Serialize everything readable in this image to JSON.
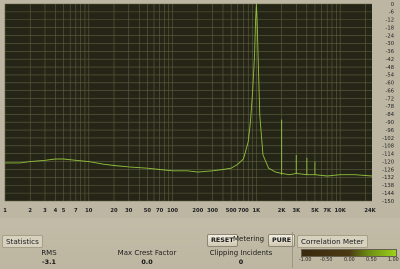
{
  "chart_data": {
    "type": "line",
    "title": "",
    "xlabel": "",
    "ylabel": "",
    "x_scale": "log",
    "xlim": [
      1,
      24000
    ],
    "ylim": [
      -150,
      0
    ],
    "grid": true,
    "x_ticks": [
      "1",
      "2",
      "3",
      "4",
      "5",
      "7",
      "10",
      "20",
      "30",
      "50",
      "70",
      "100",
      "200",
      "300",
      "500",
      "700",
      "1K",
      "2K",
      "3K",
      "5K",
      "7K",
      "10K",
      "24K"
    ],
    "y_ticks": [
      "0",
      "-6",
      "-12",
      "-18",
      "-24",
      "-30",
      "-36",
      "-42",
      "-48",
      "-54",
      "-60",
      "-66",
      "-72",
      "-78",
      "-84",
      "-90",
      "-96",
      "-102",
      "-108",
      "-114",
      "-120",
      "-126",
      "-132",
      "-138",
      "-144",
      "-150"
    ],
    "series": [
      {
        "x": [
          1,
          1.5,
          2,
          3,
          4,
          5,
          7,
          10,
          15,
          20,
          30,
          50,
          70,
          100,
          150,
          200,
          300,
          400,
          500,
          600,
          700,
          800,
          850,
          900,
          950,
          980,
          1000,
          1020,
          1050,
          1100,
          1200,
          1400,
          1700,
          2000,
          2500,
          3000,
          4000,
          5000,
          7000,
          10000,
          15000,
          24000
        ],
        "y": [
          -121,
          -121,
          -120,
          -119,
          -118,
          -118,
          -119,
          -120,
          -122,
          -123,
          -124,
          -125,
          -126,
          -127,
          -127,
          -128,
          -127,
          -126,
          -125,
          -122,
          -118,
          -105,
          -90,
          -68,
          -40,
          -12,
          0,
          -12,
          -40,
          -85,
          -115,
          -125,
          -128,
          -129,
          -130,
          -129,
          -130,
          -130,
          -131,
          -130,
          -130,
          -131
        ]
      },
      {
        "x": [
          2000,
          2000
        ],
        "y": [
          -130,
          -88
        ],
        "spike": true
      },
      {
        "x": [
          3000,
          3000
        ],
        "y": [
          -129,
          -115
        ],
        "spike": true
      },
      {
        "x": [
          4000,
          4000
        ],
        "y": [
          -130,
          -117
        ],
        "spike": true
      },
      {
        "x": [
          5000,
          5000
        ],
        "y": [
          -130,
          -120
        ],
        "spike": true
      }
    ]
  },
  "statistics": {
    "title": "Statistics",
    "rms_label": "RMS",
    "rms_value": "-3.1",
    "crest_label": "Max Crest Factor",
    "crest_value": "0.0",
    "clip_label": "Clipping Incidents",
    "clip_value": "0"
  },
  "controls": {
    "reset_label": "RESET",
    "metering_label": "Metering",
    "pure_label": "PURE"
  },
  "correlation": {
    "title": "Correlation Meter",
    "ticks": [
      "-1.00",
      "-0.50",
      "0.00",
      "0.50",
      "1.00"
    ]
  },
  "colors": {
    "plot_background": "#252517",
    "grid": "#5e5e3e",
    "trace": "#8fbe3c",
    "trace_highlight": "#c9f06a"
  }
}
